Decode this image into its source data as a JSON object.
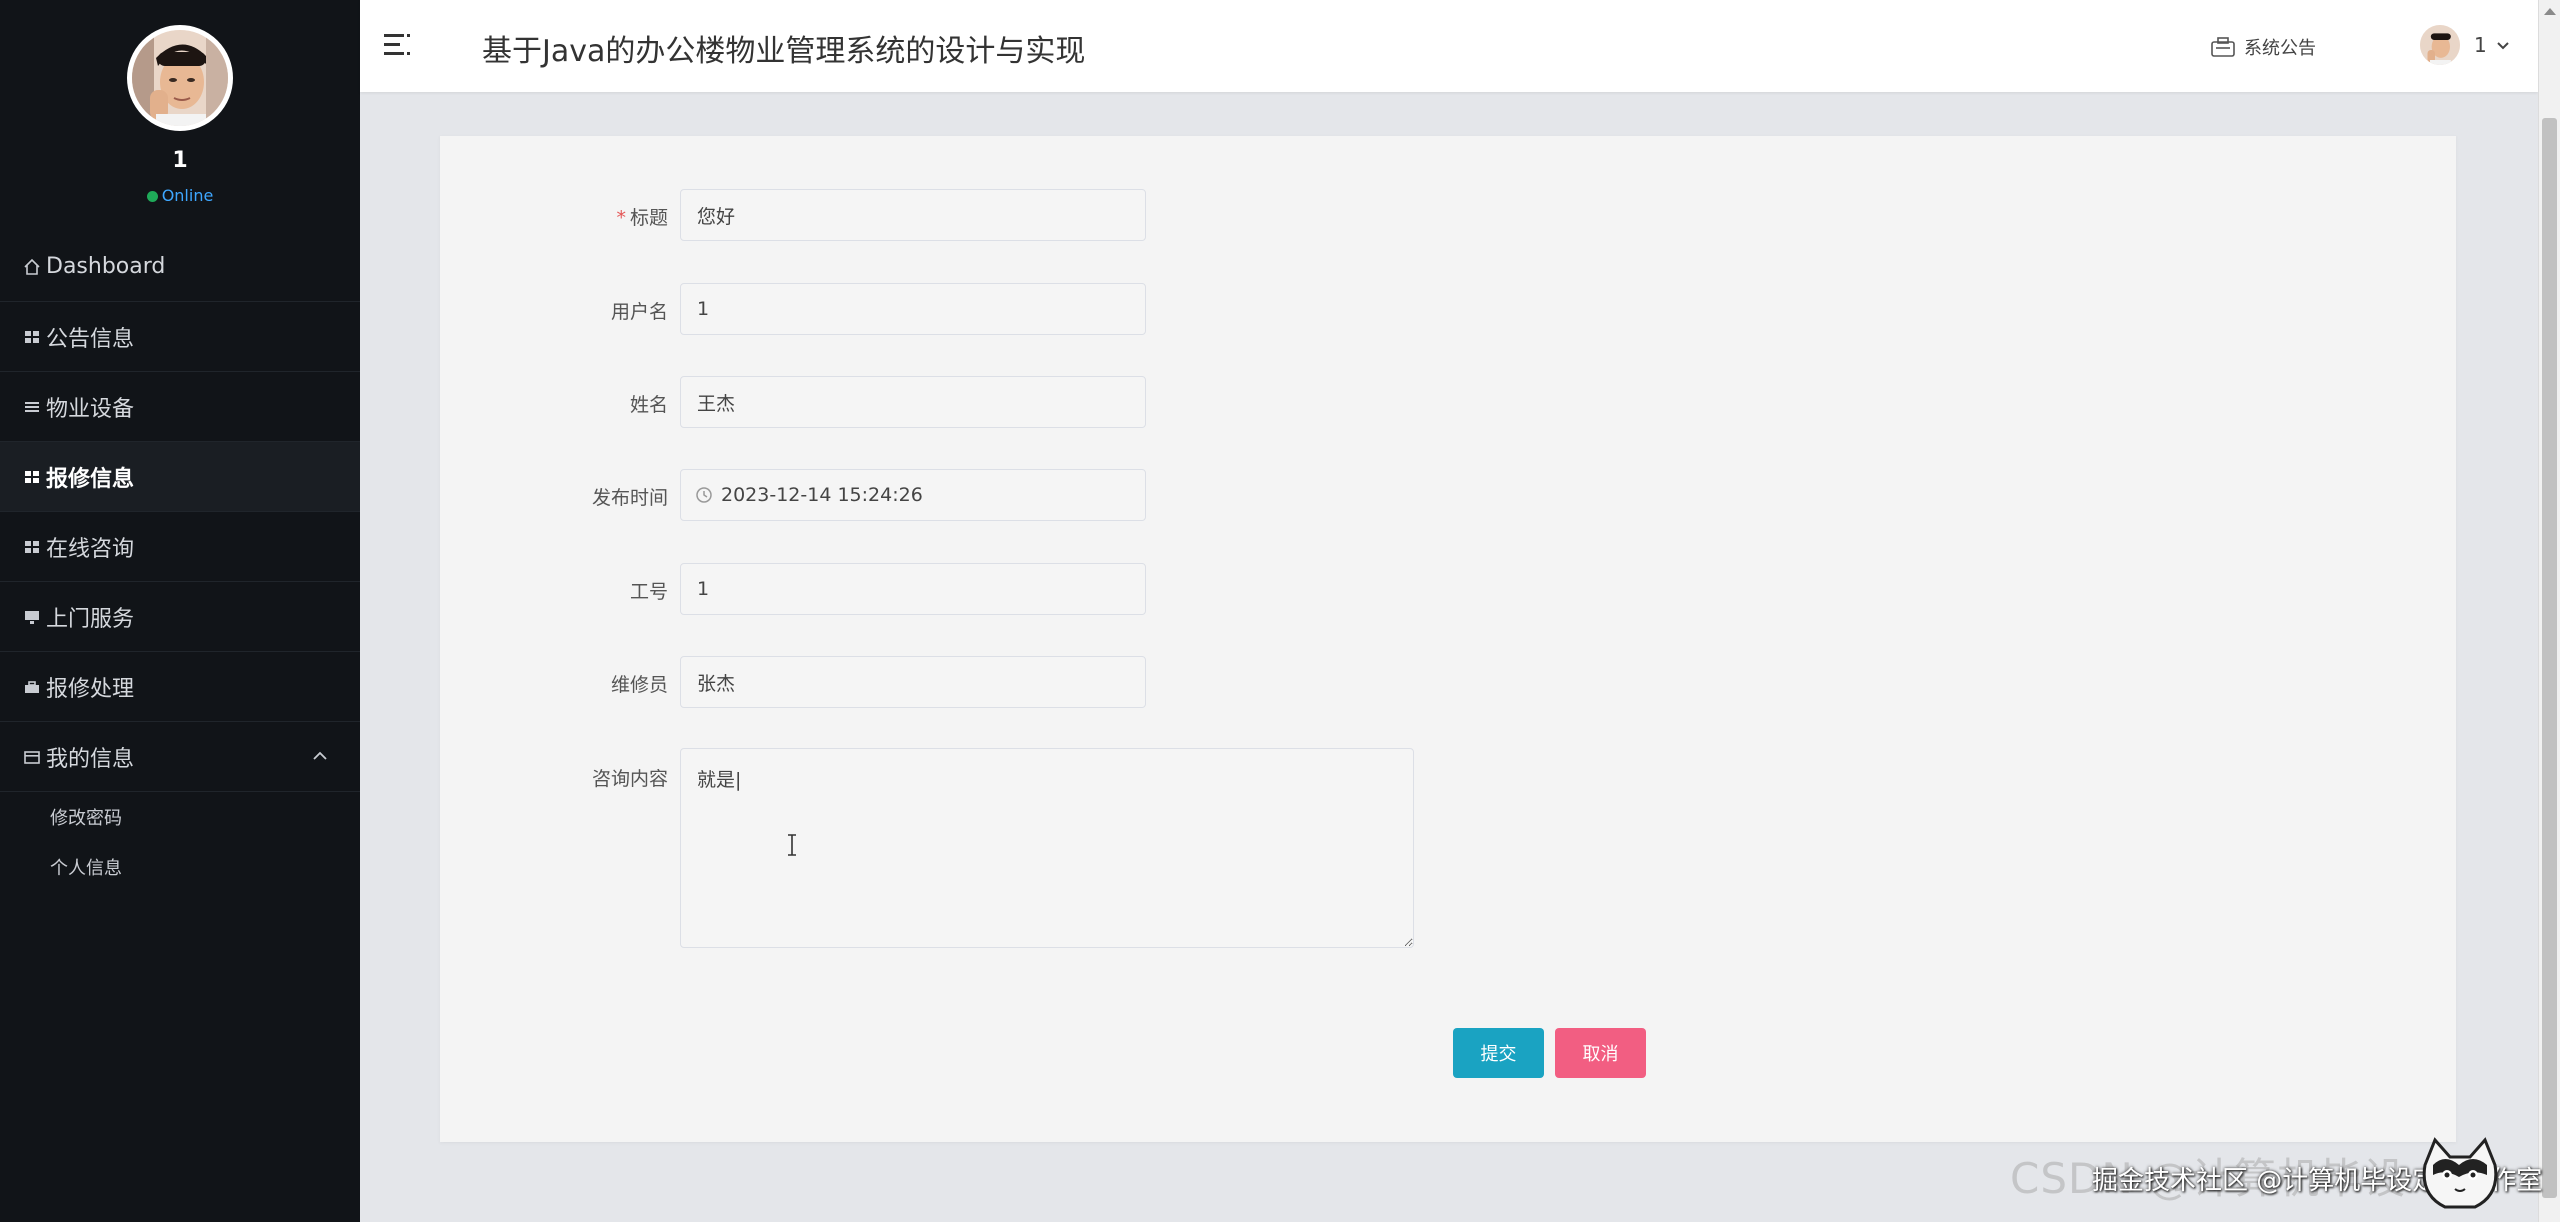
{
  "sidebar": {
    "profile": {
      "name": "1",
      "status": "Online",
      "status_color": "#1faa59"
    },
    "menu": [
      {
        "label": "Dashboard",
        "icon": "home-icon"
      },
      {
        "label": "公告信息",
        "icon": "grid-icon"
      },
      {
        "label": "物业设备",
        "icon": "list-icon"
      },
      {
        "label": "报修信息",
        "icon": "grid-icon",
        "active": true
      },
      {
        "label": "在线咨询",
        "icon": "grid-icon"
      },
      {
        "label": "上门服务",
        "icon": "monitor-icon"
      },
      {
        "label": "报修处理",
        "icon": "briefcase-icon"
      },
      {
        "label": "我的信息",
        "icon": "card-icon",
        "expanded": true
      }
    ],
    "submenu": [
      {
        "label": "修改密码"
      },
      {
        "label": "个人信息"
      }
    ]
  },
  "header": {
    "title": "基于Java的办公楼物业管理系统的设计与实现",
    "notice_label": "系统公告",
    "user_name": "1"
  },
  "form": {
    "fields": [
      {
        "label": "标题",
        "value": "您好",
        "required": true
      },
      {
        "label": "用户名",
        "value": "1"
      },
      {
        "label": "姓名",
        "value": "王杰"
      },
      {
        "label": "发布时间",
        "value": "2023-12-14 15:24:26"
      },
      {
        "label": "工号",
        "value": "1"
      },
      {
        "label": "维修员",
        "value": "张杰"
      }
    ],
    "consult": {
      "label": "咨询内容",
      "value": "就是|"
    },
    "buttons": {
      "submit": "提交",
      "cancel": "取消"
    }
  },
  "watermark": {
    "background_text": "CSDN @计算机毕设",
    "credit": "掘金技术社区 @计算机毕设定制工作室"
  },
  "colors": {
    "sidebar_bg": "#111418",
    "submit": "#1aa3c2",
    "cancel": "#f25e82",
    "required": "#e45656"
  }
}
